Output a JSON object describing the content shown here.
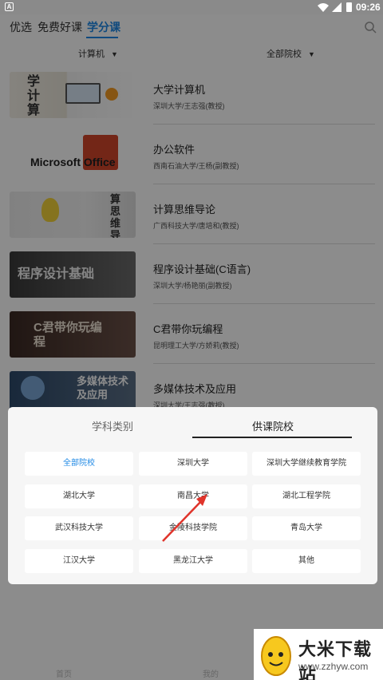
{
  "status_bar": {
    "badge": "A",
    "time": "09:26"
  },
  "top_tabs": [
    {
      "label": "优选"
    },
    {
      "label": "免费好课"
    },
    {
      "label": "学分课"
    }
  ],
  "filters": {
    "subject": "计算机",
    "school": "全部院校"
  },
  "courses": [
    {
      "title": "大学计算机",
      "subtitle": "深圳大学/王志强(教授)",
      "thumb_text": "学计算"
    },
    {
      "title": "办公软件",
      "subtitle": "西南石油大学/王杨(副教授)",
      "thumb_text": "Microsoft Office"
    },
    {
      "title": "计算思维导论",
      "subtitle": "广西科技大学/唐培和(教授)",
      "thumb_text": "算思维导"
    },
    {
      "title": "程序设计基础(C语言)",
      "subtitle": "深圳大学/杨艳丽(副教授)",
      "thumb_text": "程序设计基础"
    },
    {
      "title": "C君带你玩编程",
      "subtitle": "昆明理工大学/方娇莉(教授)",
      "thumb_text": "C君带你玩编程"
    },
    {
      "title": "多媒体技术及应用",
      "subtitle": "深圳大学/王志强(教授)",
      "thumb_text": "多媒体技术及应用"
    }
  ],
  "sheet": {
    "tabs": [
      {
        "label": "学科类别"
      },
      {
        "label": "供课院校"
      }
    ],
    "schools": [
      "全部院校",
      "深圳大学",
      "深圳大学继续教育学院",
      "湖北大学",
      "南昌大学",
      "湖北工程学院",
      "武汉科技大学",
      "金陵科技学院",
      "青岛大学",
      "江汉大学",
      "黑龙江大学",
      "其他"
    ],
    "selected_school": "全部院校"
  },
  "bottom_nav": [
    {
      "label": "首页"
    },
    {
      "label": "我的"
    }
  ],
  "watermark": {
    "title": "大米下载站",
    "url": "www.zzhyw.com"
  },
  "colors": {
    "accent": "#1e88e5",
    "annotation_arrow": "#e0342b"
  }
}
